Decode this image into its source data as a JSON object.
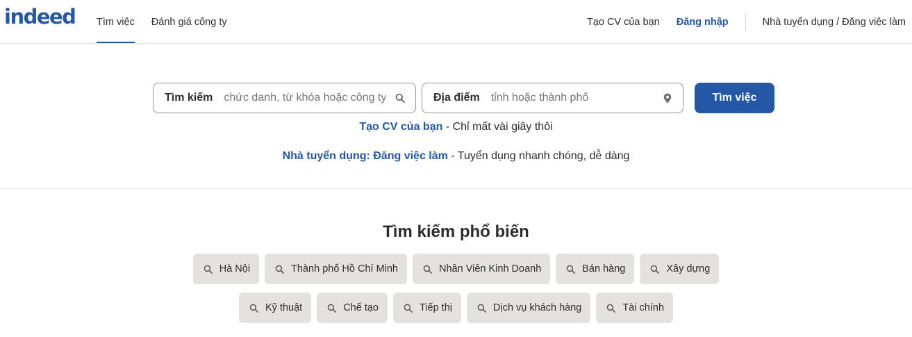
{
  "header": {
    "logo_text": "indeed",
    "nav_left": [
      "Tìm việc",
      "Đánh giá công ty"
    ],
    "create_cv": "Tạo CV của bạn",
    "login": "Đăng nhập",
    "employer": "Nhà tuyển dụng / Đăng việc làm"
  },
  "search": {
    "what_label": "Tìm kiếm",
    "what_placeholder": "chức danh, từ khóa hoặc công ty",
    "where_label": "Địa điểm",
    "where_placeholder": "tỉnh hoặc thành phố",
    "button": "Tìm việc"
  },
  "promo": {
    "cv_link": "Tạo CV của bạn",
    "cv_text": " - Chỉ mất vài giây thôi",
    "employer_link": "Nhà tuyển dụng: Đăng việc làm",
    "employer_text": " - Tuyển dụng nhanh chóng, dễ dàng"
  },
  "popular": {
    "title": "Tìm kiếm phổ biến",
    "row1": [
      "Hà Nội",
      "Thành phố Hồ Chí Minh",
      "Nhân Viên Kinh Doanh",
      "Bán hàng",
      "Xây dựng"
    ],
    "row2": [
      "Kỹ thuật",
      "Chế tạo",
      "Tiếp thị",
      "Dịch vụ khách hàng",
      "Tài chính"
    ]
  },
  "colors": {
    "brand": "#2557a7",
    "chip_bg": "#e4e2e0",
    "text": "#2d2d2d"
  },
  "icons": {
    "search": "magnifier-icon",
    "location": "location-pin-icon"
  }
}
